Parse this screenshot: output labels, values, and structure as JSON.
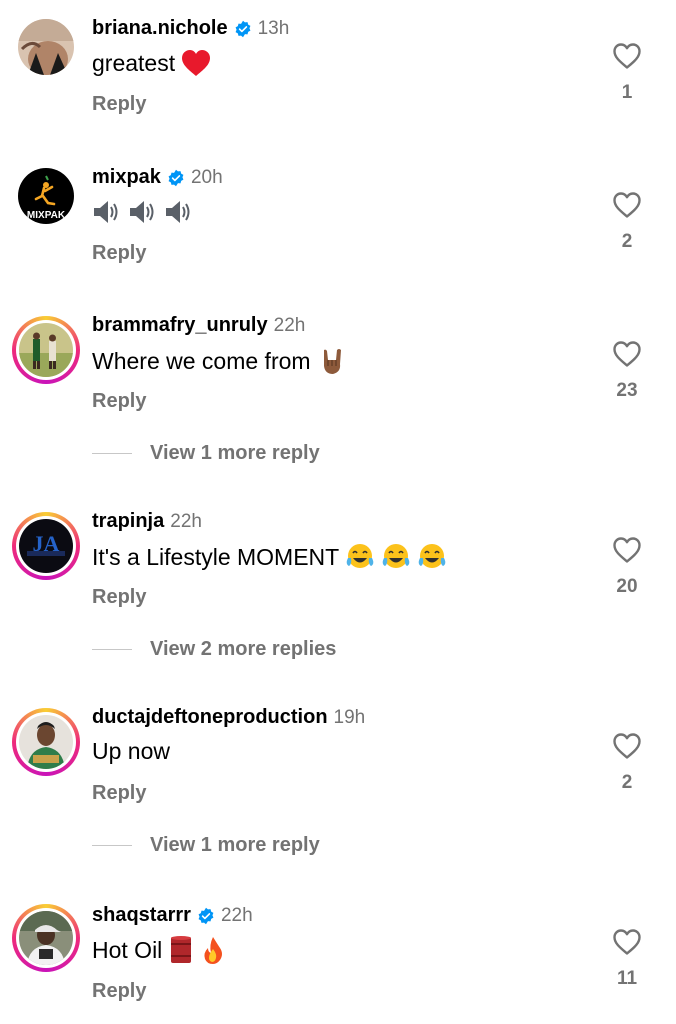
{
  "colors": {
    "verified": "#0095f6",
    "secondary_text": "#737373",
    "primary_text": "#000000"
  },
  "comments": [
    {
      "username": "briana.nichole",
      "verified": true,
      "time": "13h",
      "text": "greatest",
      "emojis": [
        "red-heart-emoji"
      ],
      "reply_label": "Reply",
      "likes": "1",
      "avatar": "avatar-photo-woman"
    },
    {
      "username": "mixpak",
      "verified": true,
      "time": "20h",
      "text": "",
      "emojis": [
        "speaker-emoji",
        "speaker-emoji",
        "speaker-emoji"
      ],
      "reply_label": "Reply",
      "likes": "2",
      "avatar": "mixpak-logo",
      "avatar_label": "MIXPAK"
    },
    {
      "username": "brammafry_unruly",
      "verified": false,
      "time": "22h",
      "text": "Where we come from",
      "emojis": [
        "sign-of-horns-emoji"
      ],
      "reply_label": "Reply",
      "likes": "23",
      "avatar": "avatar-photo-field",
      "view_more": "View 1 more reply"
    },
    {
      "username": "trapinja",
      "verified": false,
      "time": "22h",
      "text": "It's a Lifestyle MOMENT",
      "emojis": [
        "tears-of-joy-emoji",
        "tears-of-joy-emoji",
        "tears-of-joy-emoji"
      ],
      "reply_label": "Reply",
      "likes": "20",
      "avatar": "trapinja-logo",
      "avatar_label": "JA",
      "view_more": "View 2 more replies"
    },
    {
      "username": "ductajdeftoneproduction",
      "verified": false,
      "time": "19h",
      "text": "Up now",
      "emojis": [],
      "reply_label": "Reply",
      "likes": "2",
      "avatar": "avatar-photo-man",
      "view_more": "View 1 more reply"
    },
    {
      "username": "shaqstarrr",
      "verified": true,
      "time": "22h",
      "text": "Hot Oil",
      "emojis": [
        "oil-drum-emoji",
        "fire-emoji"
      ],
      "reply_label": "Reply",
      "likes": "11",
      "avatar": "avatar-photo-cap"
    }
  ]
}
